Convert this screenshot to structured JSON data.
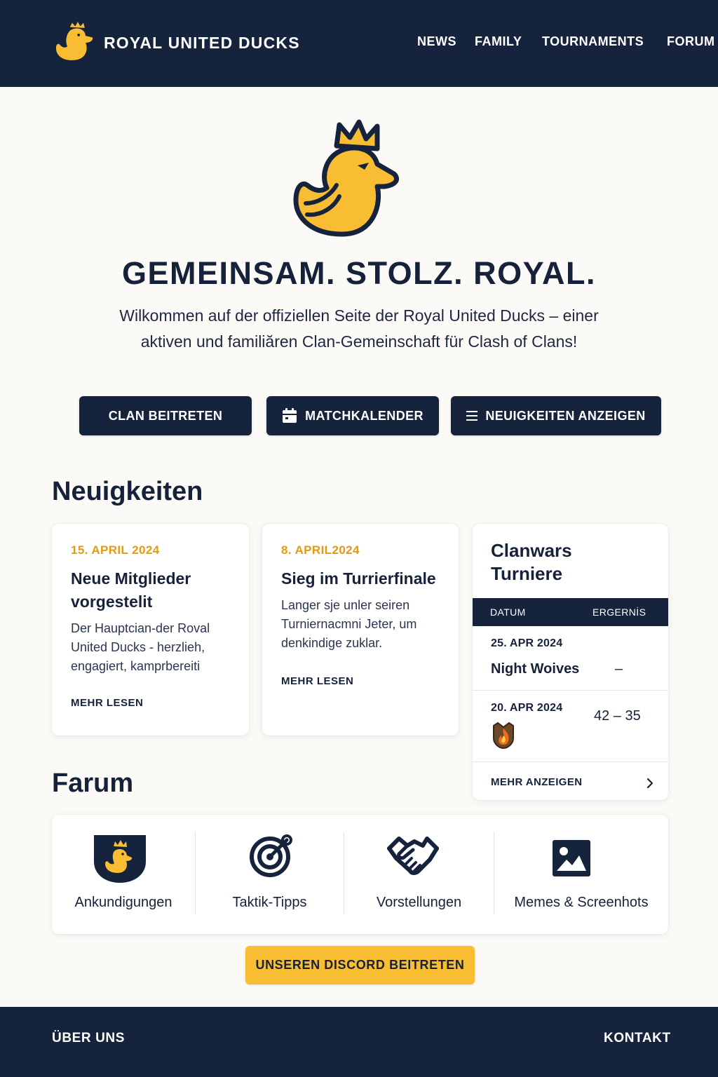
{
  "header": {
    "brand_name": "ROYAL UNITED DUCKS",
    "nav": [
      {
        "label": "NEWS"
      },
      {
        "label": "FAMILY"
      },
      {
        "label": "TOURNAMENTS"
      },
      {
        "label": "FORUM"
      }
    ]
  },
  "hero": {
    "title": "GEMEINSAM. STOLZ. ROYAL.",
    "lead": "Wilkommen auf der offiziellen Seite der Royal United Ducks – einer aktiven und familiăren Clan-Gemeinschaft für Clash of Clans!",
    "buttons": [
      {
        "label": "CLAN BEITRETEN"
      },
      {
        "label": "MATCHKALENDER",
        "icon": "calendar-icon"
      },
      {
        "label": "NEUIGKEITEN ANZEIGEN",
        "icon": "list-icon"
      }
    ]
  },
  "news": {
    "heading": "Neuigkeiten",
    "cards": [
      {
        "date": "15. APRIL 2024",
        "title": "Neue Mitglieder vorgestelit",
        "text": "Der Hauptcian-der Roval United Ducks - herzlieh, engagiert, kamprbereiti",
        "more": "MEHR LESEN"
      },
      {
        "date": "8. APRIL2024",
        "title": "Sieg im Turrierfinale",
        "text": "Langer sje unler seiren Turniernacmni Jeter, um denkindige zuklar.",
        "more": "MEHR LESEN"
      }
    ]
  },
  "clanwars": {
    "title": "Clanwars Turniere",
    "col_date": "DATUM",
    "col_result": "ERGERNİS",
    "rows": [
      {
        "date": "25. APR 2024",
        "team": "Night Woives",
        "result": "–"
      },
      {
        "date": "20. APR 2024",
        "team_icon": "fire-crest-icon",
        "result": "42 – 35"
      }
    ],
    "more": "MEHR ANZEIGEN"
  },
  "forum": {
    "heading": "Farum",
    "categories": [
      {
        "label": "Ankundigungen",
        "icon": "duck-shield-icon"
      },
      {
        "label": "Taktik-Tipps",
        "icon": "target-icon"
      },
      {
        "label": "Vorstellungen",
        "icon": "handshake-icon"
      },
      {
        "label": "Memes & Screenhots",
        "icon": "image-icon"
      }
    ]
  },
  "discord_button": "UNSEREN DISCORD BEITRETEN",
  "footer": {
    "about": "ÜBER UNS",
    "contact": "KONTAKT"
  },
  "colors": {
    "navy": "#16233c",
    "accent": "#f8bd32",
    "date_orange": "#e39a12",
    "background": "#fbfaf6"
  }
}
